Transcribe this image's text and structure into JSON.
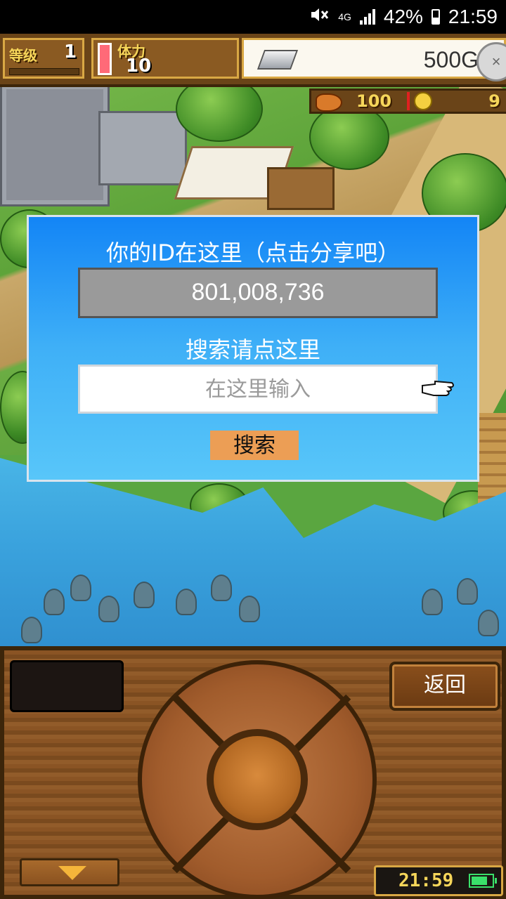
{
  "status_bar": {
    "network": "4G",
    "battery_percent": "42%",
    "time": "21:59",
    "icons": [
      "mute-icon",
      "network-icon",
      "signal-icon",
      "battery-icon"
    ]
  },
  "hud": {
    "level_label": "等级",
    "level_value": "1",
    "stamina_label": "体力",
    "stamina_value": "10",
    "money": "500G",
    "food_value": "100",
    "medal_value": "9"
  },
  "dialog": {
    "title": "你的ID在这里（点击分享吧）",
    "player_id": "801,008,736",
    "search_label": "搜索请点这里",
    "search_placeholder": "在这里输入",
    "search_button": "搜索"
  },
  "controls": {
    "back_button": "返回",
    "clock_time": "21:59"
  },
  "colors": {
    "dialog_top": "#1385f6",
    "dialog_bottom": "#58c6f9",
    "search_button": "#ec9e55",
    "id_box": "#9a9a9a"
  }
}
